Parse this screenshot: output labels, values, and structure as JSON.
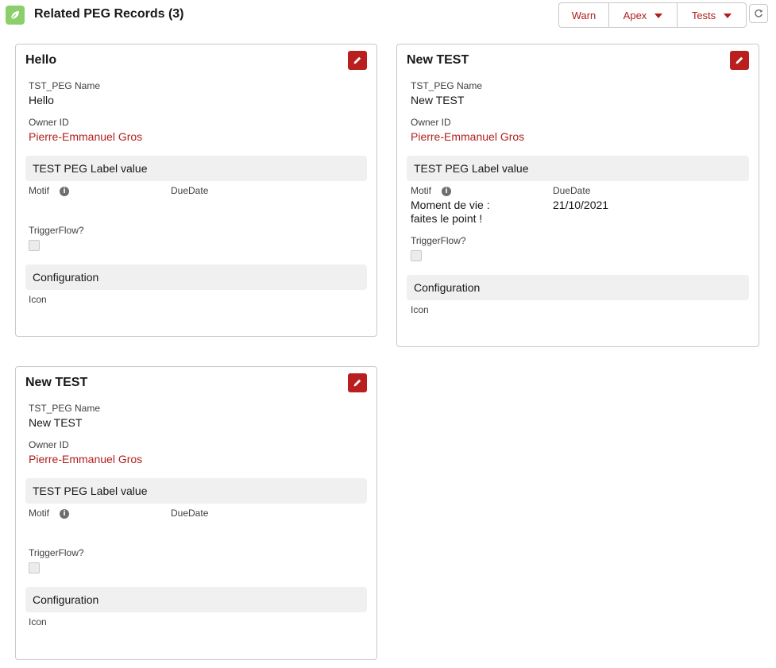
{
  "header": {
    "title": "Related PEG Records (3)",
    "app_icon": "leaf-icon",
    "buttons": {
      "warn": "Warn",
      "apex": "Apex",
      "tests": "Tests"
    },
    "refresh_icon": "refresh-icon"
  },
  "labels": {
    "name": "TST_PEG Name",
    "owner": "Owner ID",
    "section_test": "TEST PEG Label value",
    "motif": "Motif",
    "due_date": "DueDate",
    "trigger_flow": "TriggerFlow?",
    "section_config": "Configuration",
    "icon": "Icon"
  },
  "cards": [
    {
      "title": "Hello",
      "name": "Hello",
      "owner": "Pierre-Emmanuel Gros",
      "motif": "",
      "due_date": "",
      "trigger_flow": false
    },
    {
      "title": "New TEST",
      "name": "New TEST",
      "owner": "Pierre-Emmanuel Gros",
      "motif_line1": "Moment de vie :",
      "motif_line2": "faites le point !",
      "due_date": "21/10/2021",
      "trigger_flow": false
    },
    {
      "title": "New TEST",
      "name": "New TEST",
      "owner": "Pierre-Emmanuel Gros",
      "motif": "",
      "due_date": "",
      "trigger_flow": false
    }
  ],
  "colors": {
    "brand_red": "#ba1f1f",
    "link_red": "#b0201e",
    "app_icon_green": "#8bcf6a",
    "section_bg": "#f0f0f0"
  }
}
